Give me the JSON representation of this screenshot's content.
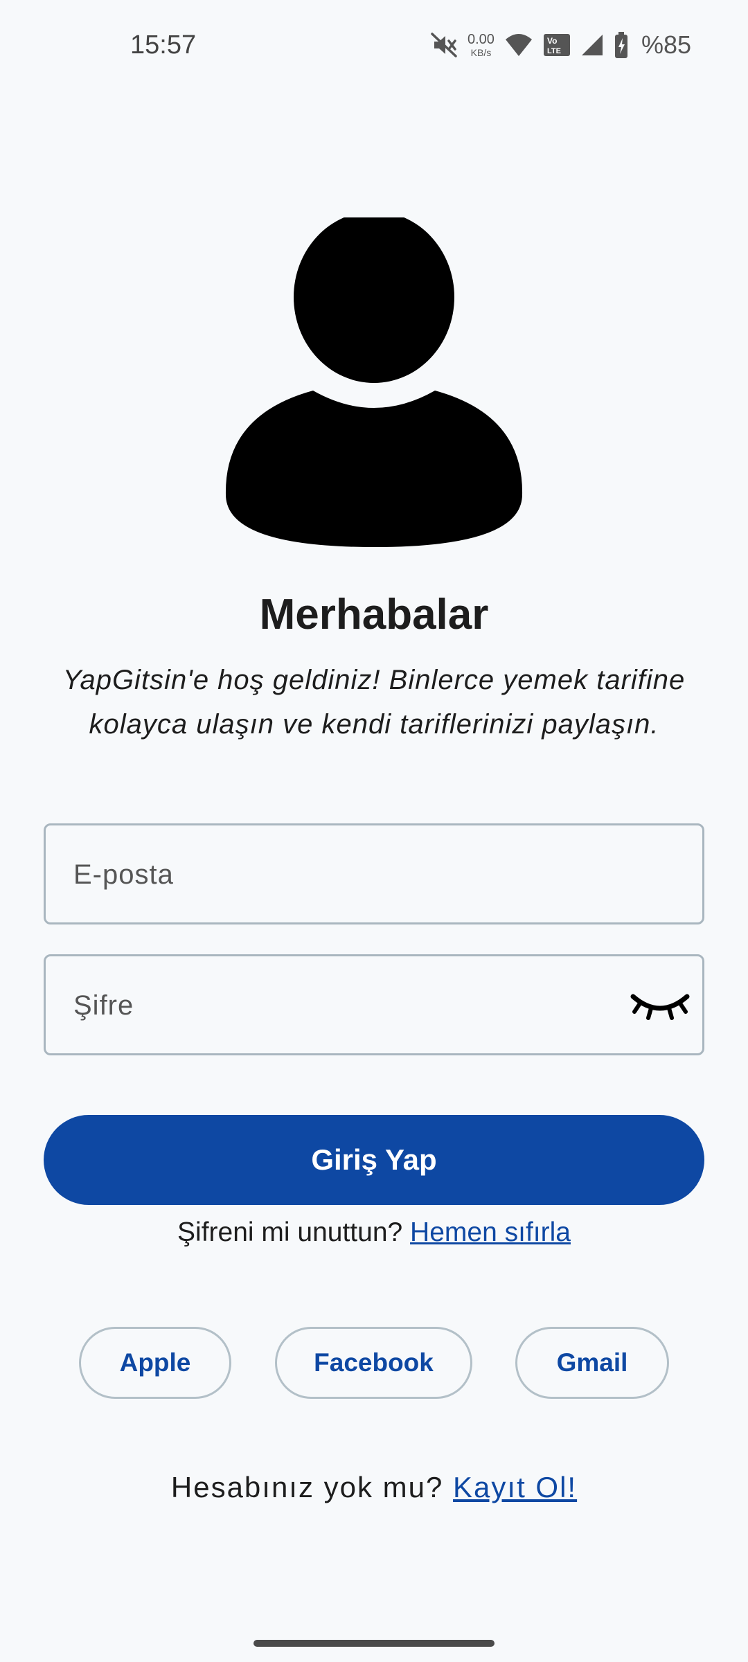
{
  "status_bar": {
    "time": "15:57",
    "net_speed_value": "0.00",
    "net_speed_unit": "KB/s",
    "battery_percent": "%85",
    "icons": [
      "mute-icon",
      "wifi-icon",
      "volte-icon",
      "signal-icon",
      "battery-icon"
    ]
  },
  "header": {
    "title": "Merhabalar",
    "subtitle": "YapGitsin'e hoş geldiniz! Binlerce yemek tarifine kolayca ulaşın ve kendi tariflerinizi paylaşın."
  },
  "form": {
    "email_placeholder": "E-posta",
    "password_placeholder": "Şifre",
    "login_label": "Giriş Yap",
    "forgot_text": "Şifreni mi unuttun?",
    "forgot_link": "Hemen sıfırla"
  },
  "social": {
    "apple_label": "Apple",
    "facebook_label": "Facebook",
    "gmail_label": "Gmail"
  },
  "signup": {
    "text": "Hesabınız yok mu?",
    "link": "Kayıt Ol!"
  },
  "colors": {
    "primary": "#0e48a3",
    "background": "#f7f9fb",
    "border": "#a9b6bf"
  }
}
